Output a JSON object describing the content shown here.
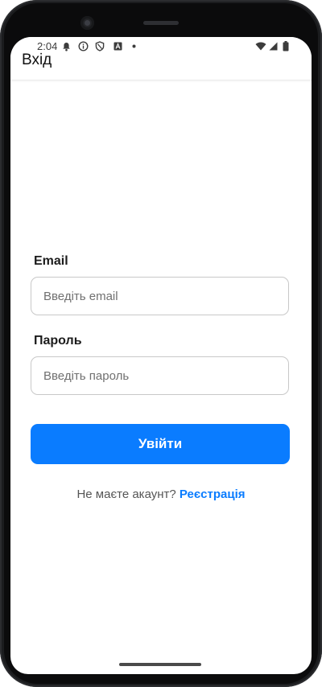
{
  "status_bar": {
    "time": "2:04",
    "icons": [
      "notification-bell-icon",
      "info-icon",
      "shield-icon",
      "font-icon",
      "dot-icon",
      "wifi-icon",
      "signal-icon",
      "battery-icon"
    ]
  },
  "header": {
    "title": "Вхід"
  },
  "form": {
    "email_label": "Email",
    "email_placeholder": "Введіть email",
    "email_value": "",
    "password_label": "Пароль",
    "password_placeholder": "Введіть пароль",
    "password_value": "",
    "submit_label": "Увійти"
  },
  "footer": {
    "prompt": "Не маєте акаунт?",
    "register_link": "Реєстрація"
  },
  "colors": {
    "accent": "#0a7cff",
    "background": "#ffffff",
    "bezel": "#1b1c1e"
  }
}
